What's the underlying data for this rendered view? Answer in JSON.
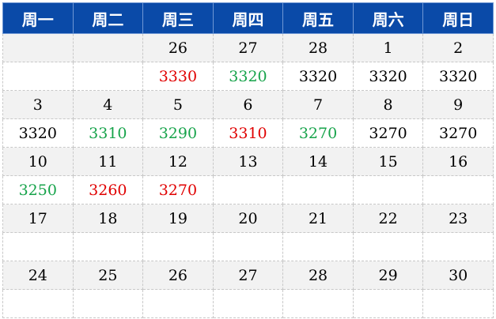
{
  "weekdays": [
    "周一",
    "周二",
    "周三",
    "周四",
    "周五",
    "周六",
    "周日"
  ],
  "weeks": [
    {
      "dates": [
        "",
        "",
        "26",
        "27",
        "28",
        "1",
        "2"
      ],
      "prices": [
        {
          "value": "",
          "color": "black"
        },
        {
          "value": "",
          "color": "black"
        },
        {
          "value": "3330",
          "color": "red"
        },
        {
          "value": "3320",
          "color": "green"
        },
        {
          "value": "3320",
          "color": "black"
        },
        {
          "value": "3320",
          "color": "black"
        },
        {
          "value": "3320",
          "color": "black"
        }
      ]
    },
    {
      "dates": [
        "3",
        "4",
        "5",
        "6",
        "7",
        "8",
        "9"
      ],
      "prices": [
        {
          "value": "3320",
          "color": "black"
        },
        {
          "value": "3310",
          "color": "green"
        },
        {
          "value": "3290",
          "color": "green"
        },
        {
          "value": "3310",
          "color": "red"
        },
        {
          "value": "3270",
          "color": "green"
        },
        {
          "value": "3270",
          "color": "black"
        },
        {
          "value": "3270",
          "color": "black"
        }
      ]
    },
    {
      "dates": [
        "10",
        "11",
        "12",
        "13",
        "14",
        "15",
        "16"
      ],
      "prices": [
        {
          "value": "3250",
          "color": "green"
        },
        {
          "value": "3260",
          "color": "red"
        },
        {
          "value": "3270",
          "color": "red"
        },
        {
          "value": "",
          "color": "black"
        },
        {
          "value": "",
          "color": "black"
        },
        {
          "value": "",
          "color": "black"
        },
        {
          "value": "",
          "color": "black"
        }
      ]
    },
    {
      "dates": [
        "17",
        "18",
        "19",
        "20",
        "21",
        "22",
        "23"
      ],
      "prices": [
        {
          "value": "",
          "color": "black"
        },
        {
          "value": "",
          "color": "black"
        },
        {
          "value": "",
          "color": "black"
        },
        {
          "value": "",
          "color": "black"
        },
        {
          "value": "",
          "color": "black"
        },
        {
          "value": "",
          "color": "black"
        },
        {
          "value": "",
          "color": "black"
        }
      ]
    },
    {
      "dates": [
        "24",
        "25",
        "26",
        "27",
        "28",
        "29",
        "30"
      ],
      "prices": [
        {
          "value": "",
          "color": "black"
        },
        {
          "value": "",
          "color": "black"
        },
        {
          "value": "",
          "color": "black"
        },
        {
          "value": "",
          "color": "black"
        },
        {
          "value": "",
          "color": "black"
        },
        {
          "value": "",
          "color": "black"
        },
        {
          "value": "",
          "color": "black"
        }
      ]
    }
  ],
  "colors": {
    "header_bg": "#0a4aa8",
    "up": "#e00000",
    "down": "#16a34a",
    "flat": "#000000"
  }
}
